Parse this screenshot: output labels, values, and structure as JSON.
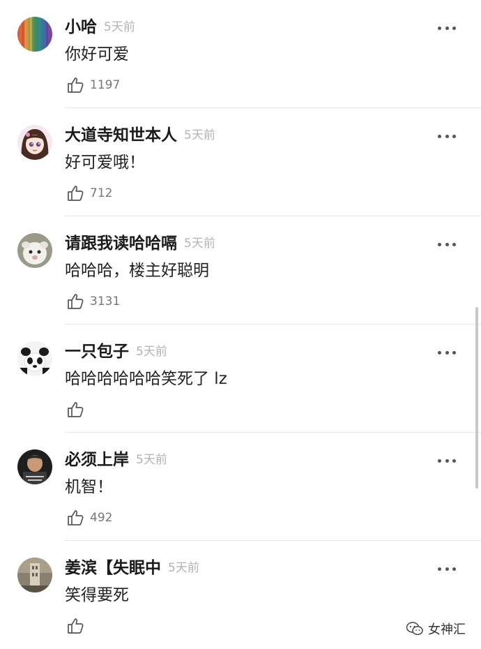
{
  "comments": [
    {
      "username": "小哈",
      "time": "5天前",
      "content": "你好可爱",
      "likes": "1197"
    },
    {
      "username": "大道寺知世本人",
      "time": "5天前",
      "content": "好可爱哦！",
      "likes": "712"
    },
    {
      "username": "请跟我读哈哈嗝",
      "time": "5天前",
      "content": "哈哈哈，楼主好聪明",
      "likes": "3131"
    },
    {
      "username": "一只包子",
      "time": "5天前",
      "content": "哈哈哈哈哈哈笑死了 lz",
      "likes": ""
    },
    {
      "username": "必须上岸",
      "time": "5天前",
      "content": "机智！",
      "likes": "492"
    },
    {
      "username": "姜滨【失眠中",
      "time": "5天前",
      "content": "笑得要死",
      "likes": ""
    }
  ],
  "watermark": {
    "text": "女神汇",
    "icon": "wechat-icon"
  },
  "icons": {
    "like": "thumbs-up-icon",
    "more": "more-dots-icon"
  }
}
